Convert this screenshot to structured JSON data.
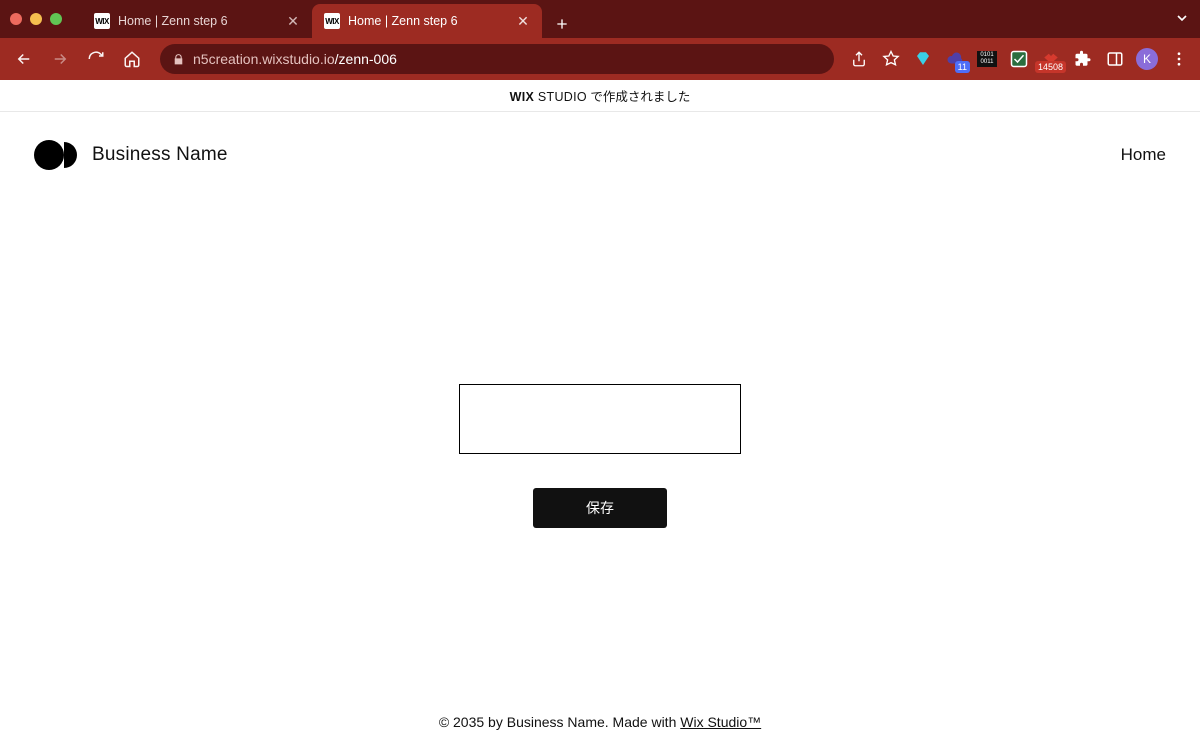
{
  "browser": {
    "tabs": [
      {
        "title": "Home | Zenn step 6",
        "favicon": "WIX",
        "active": false
      },
      {
        "title": "Home | Zenn step 6",
        "favicon": "WIX",
        "active": true
      }
    ],
    "url_host": "n5creation.wixstudio.io",
    "url_path": "/zenn-006",
    "profile_initial": "K",
    "ext_badge_11": "11",
    "ext_badge_14508": "14508",
    "binary_line1": "0101",
    "binary_line2": "0011"
  },
  "banner": {
    "brand_wix": "WIX",
    "brand_studio": " STUDIO",
    "suffix": " で作成されました"
  },
  "site": {
    "business_name": "Business Name",
    "nav_home": "Home",
    "save_button": "保存",
    "input_value": ""
  },
  "footer": {
    "prefix": "© 2035 by Business Name. Made with ",
    "link": "Wix Studio™"
  }
}
